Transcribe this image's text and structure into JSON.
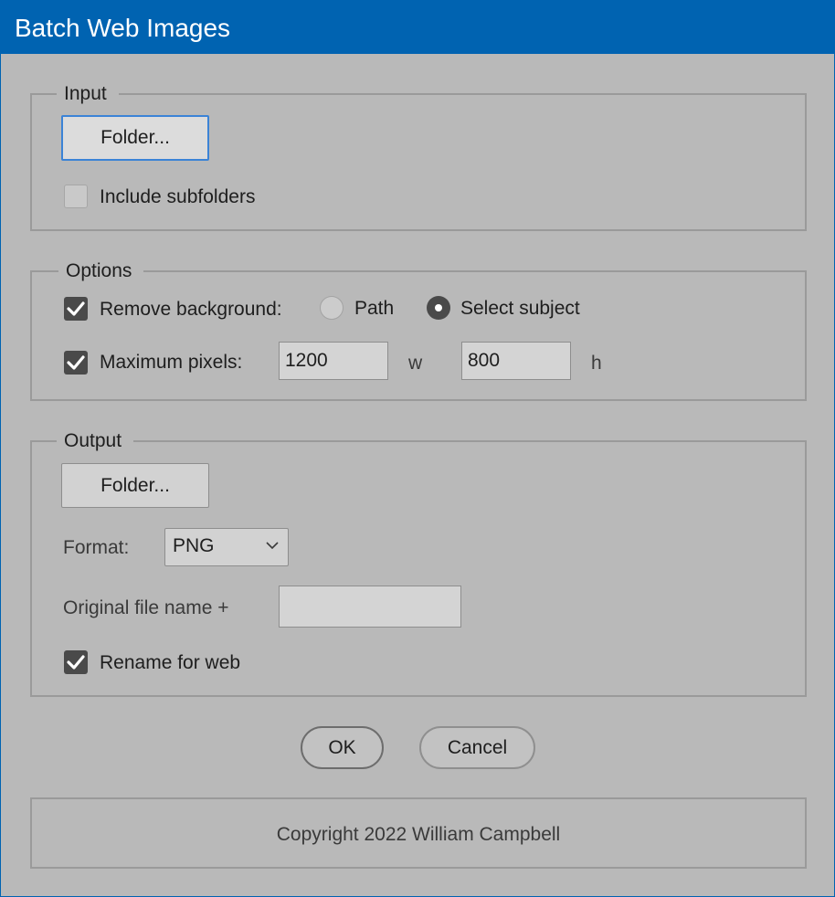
{
  "window": {
    "title": "Batch Web Images"
  },
  "input": {
    "legend": "Input",
    "folder_button": "Folder...",
    "include_subfolders_label": "Include subfolders",
    "include_subfolders_checked": false
  },
  "options": {
    "legend": "Options",
    "remove_background_label": "Remove background:",
    "remove_background_checked": true,
    "radio_path_label": "Path",
    "radio_select_subject_label": "Select subject",
    "selected_method": "Select subject",
    "max_pixels_label": "Maximum pixels:",
    "max_pixels_checked": true,
    "width_value": "1200",
    "width_unit": "w",
    "height_value": "800",
    "height_unit": "h"
  },
  "output": {
    "legend": "Output",
    "folder_button": "Folder...",
    "format_label": "Format:",
    "format_value": "PNG",
    "suffix_label": "Original file name +",
    "suffix_value": "",
    "rename_label": "Rename for web",
    "rename_checked": true
  },
  "buttons": {
    "ok": "OK",
    "cancel": "Cancel"
  },
  "footer": {
    "copyright": "Copyright 2022 William Campbell"
  },
  "colors": {
    "titlebar": "#0063b1",
    "background": "#b9b9b9",
    "focus": "#3b83d6"
  },
  "icons": {
    "checkmark": "checkmark-icon",
    "dropdown": "chevron-down-icon"
  }
}
